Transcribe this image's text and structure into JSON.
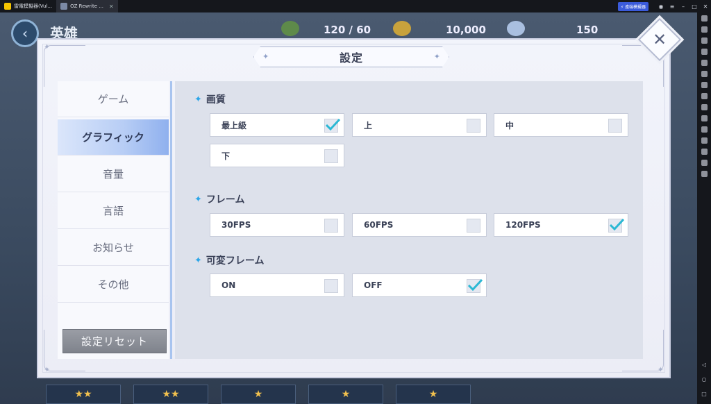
{
  "emulator": {
    "tabs": [
      {
        "label": "雷電模擬器(Vul...",
        "icon": "ldplayer-logo-icon"
      },
      {
        "label": "OZ Rewrite ...",
        "icon": "game-thumbnail-icon",
        "close": "✕"
      }
    ],
    "badge_label": "⚡ 遠端模擬器"
  },
  "hud": {
    "title": "英雄",
    "stamina": "120 / 60",
    "gold": "10,000",
    "gems": "150"
  },
  "bottom_cards": [
    {
      "stars": "★★"
    },
    {
      "stars": "★★"
    },
    {
      "stars": "★"
    },
    {
      "stars": "★"
    },
    {
      "stars": "★"
    }
  ],
  "modal": {
    "title": "設定",
    "close_label": "✕",
    "sidebar": {
      "items": [
        {
          "label": "ゲーム",
          "active": false
        },
        {
          "label": "グラフィック",
          "active": true
        },
        {
          "label": "音量",
          "active": false
        },
        {
          "label": "言語",
          "active": false
        },
        {
          "label": "お知らせ",
          "active": false
        },
        {
          "label": "その他",
          "active": false
        }
      ],
      "reset_label": "設定リセット"
    },
    "sections": {
      "quality": {
        "title": "画質",
        "options": [
          {
            "label": "最上級",
            "checked": true
          },
          {
            "label": "上",
            "checked": false
          },
          {
            "label": "中",
            "checked": false
          },
          {
            "label": "下",
            "checked": false
          }
        ]
      },
      "frame": {
        "title": "フレーム",
        "options": [
          {
            "label": "30FPS",
            "checked": false
          },
          {
            "label": "60FPS",
            "checked": false
          },
          {
            "label": "120FPS",
            "checked": true
          }
        ]
      },
      "vrr": {
        "title": "可変フレーム",
        "options": [
          {
            "label": "ON",
            "checked": false
          },
          {
            "label": "OFF",
            "checked": true
          }
        ]
      }
    }
  },
  "colors": {
    "accent_check": "#2bb8d4",
    "section_star": "#2da6e8",
    "active_tab": "#9ab6ef"
  }
}
